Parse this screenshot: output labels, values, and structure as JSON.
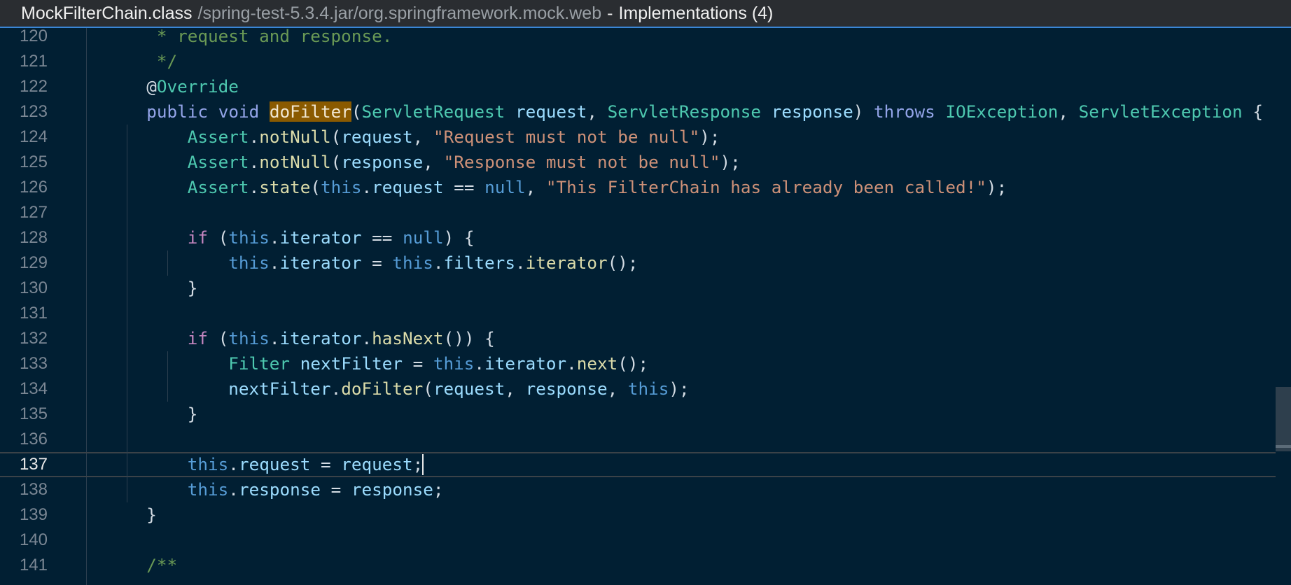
{
  "titlebar": {
    "file_name": "MockFilterChain.class",
    "file_path": "/spring-test-5.3.4.jar/org.springframework.mock.web",
    "separator": "-",
    "implementations": "Implementations (4)"
  },
  "editor": {
    "current_line": "137",
    "lines": [
      {
        "num": "120",
        "text": "   * request and response."
      },
      {
        "num": "121",
        "text": "   */"
      },
      {
        "num": "122",
        "text": "  @Override"
      },
      {
        "num": "123",
        "text": "  public void doFilter(ServletRequest request, ServletResponse response) throws IOException, ServletException {"
      },
      {
        "num": "124",
        "text": "      Assert.notNull(request, \"Request must not be null\");"
      },
      {
        "num": "125",
        "text": "      Assert.notNull(response, \"Response must not be null\");"
      },
      {
        "num": "126",
        "text": "      Assert.state(this.request == null, \"This FilterChain has already been called!\");"
      },
      {
        "num": "127",
        "text": ""
      },
      {
        "num": "128",
        "text": "      if (this.iterator == null) {"
      },
      {
        "num": "129",
        "text": "          this.iterator = this.filters.iterator();"
      },
      {
        "num": "130",
        "text": "      }"
      },
      {
        "num": "131",
        "text": ""
      },
      {
        "num": "132",
        "text": "      if (this.iterator.hasNext()) {"
      },
      {
        "num": "133",
        "text": "          Filter nextFilter = this.iterator.next();"
      },
      {
        "num": "134",
        "text": "          nextFilter.doFilter(request, response, this);"
      },
      {
        "num": "135",
        "text": "      }"
      },
      {
        "num": "136",
        "text": ""
      },
      {
        "num": "137",
        "text": "      this.request = request;"
      },
      {
        "num": "138",
        "text": "      this.response = response;"
      },
      {
        "num": "139",
        "text": "  }"
      },
      {
        "num": "140",
        "text": ""
      },
      {
        "num": "141",
        "text": "  /**"
      }
    ]
  },
  "colors": {
    "background": "#011f33",
    "titlebar": "#2a2d31",
    "accent": "#3a86d6",
    "highlight": "#8a5a00"
  }
}
